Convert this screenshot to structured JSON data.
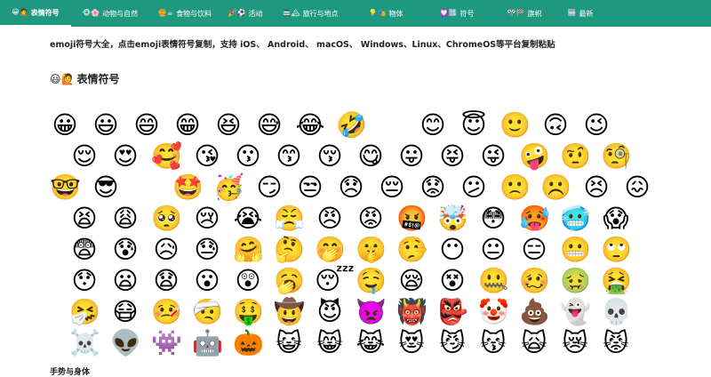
{
  "nav": [
    {
      "icon": "😀🙍",
      "label": "表情符号",
      "active": true
    },
    {
      "icon": "🐵🌸",
      "label": "动物与自然"
    },
    {
      "icon": "🍔☕",
      "label": "食物与饮料"
    },
    {
      "icon": "🎉⚽",
      "label": "活动"
    },
    {
      "icon": "🚍🏔",
      "label": "旅行与地点"
    },
    {
      "icon": "💡🎭",
      "label": "物体"
    },
    {
      "icon": "💟🔠",
      "label": "符号"
    },
    {
      "icon": "🎌🏁",
      "label": "旗帜"
    },
    {
      "icon": "🆕",
      "label": "最新"
    }
  ],
  "intro": "emoji符号大全，点击emoji表情符号复制，支持 iOS、 Android、 macOS、 Windows、Linux、ChromeOS等平台复制粘贴",
  "section": {
    "icon": "😃🙋",
    "title": "表情符号"
  },
  "emoji_rows": [
    [
      "😀",
      "😃",
      "😄",
      "😁",
      "😆",
      "😅",
      "😂",
      "🤣",
      "",
      "😊",
      "😇",
      "🙂",
      "🙃",
      "😉"
    ],
    [
      "😌",
      "😍",
      "🥰",
      "😘",
      "😗",
      "😙",
      "😚",
      "😋",
      "😛",
      "😝",
      "😜",
      "🤪",
      "🤨",
      "🧐"
    ],
    [
      "🤓",
      "😎",
      "",
      "🤩",
      "🥳",
      "😏",
      "😒",
      "😞",
      "😔",
      "😟",
      "😕",
      "🙁",
      "☹️",
      "😣",
      "😖"
    ],
    [
      "😫",
      "😩",
      "🥺",
      "😢",
      "😭",
      "😤",
      "😠",
      "😡",
      "🤬",
      "🤯",
      "😳",
      "🥵",
      "🥶",
      "😱"
    ],
    [
      "😨",
      "😰",
      "😥",
      "😓",
      "🤗",
      "🤔",
      "🤭",
      "🤫",
      "🤥",
      "😶",
      "😐",
      "😑",
      "😬",
      "🙄"
    ],
    [
      "😯",
      "😦",
      "😧",
      "😮",
      "😲",
      "🥱",
      "😴",
      "🤤",
      "😪",
      "😵",
      "🤐",
      "🥴",
      "🤢",
      "🤮"
    ],
    [
      "🤧",
      "😷",
      "🤒",
      "🤕",
      "🤑",
      "🤠",
      "😈",
      "👿",
      "👹",
      "👺",
      "🤡",
      "💩",
      "👻",
      "💀"
    ],
    [
      "☠️",
      "👽",
      "👾",
      "🤖",
      "🎃",
      "😺",
      "😸",
      "😹",
      "😻",
      "😼",
      "😽",
      "🙀",
      "😿",
      "😾"
    ]
  ],
  "subsection_title": "手势与身体"
}
